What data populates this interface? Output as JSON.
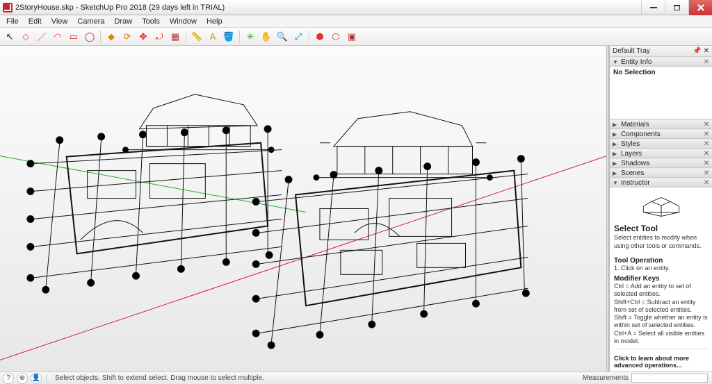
{
  "title": "2StoryHouse.skp - SketchUp Pro 2018 (29 days left in TRIAL)",
  "menu": [
    "File",
    "Edit",
    "View",
    "Camera",
    "Draw",
    "Tools",
    "Window",
    "Help"
  ],
  "toolbar": [
    {
      "id": "select",
      "glyph": "↖",
      "color": "#222"
    },
    {
      "id": "eraser",
      "glyph": "◇",
      "color": "#e48"
    },
    {
      "id": "line",
      "glyph": "／",
      "color": "#e23"
    },
    {
      "id": "arc",
      "glyph": "◠",
      "color": "#e23"
    },
    {
      "id": "rect",
      "glyph": "▭",
      "color": "#d22"
    },
    {
      "id": "circle",
      "glyph": "◯",
      "color": "#b22"
    },
    {
      "id": "sep"
    },
    {
      "id": "pushpull",
      "glyph": "◆",
      "color": "#d80"
    },
    {
      "id": "offset",
      "glyph": "⟳",
      "color": "#d80"
    },
    {
      "id": "move",
      "glyph": "✥",
      "color": "#d22"
    },
    {
      "id": "rotate",
      "glyph": "⤾",
      "color": "#d22"
    },
    {
      "id": "scale",
      "glyph": "▦",
      "color": "#b33"
    },
    {
      "id": "sep"
    },
    {
      "id": "tape",
      "glyph": "📏",
      "color": "#c90"
    },
    {
      "id": "text",
      "glyph": "A",
      "color": "#c90"
    },
    {
      "id": "paint",
      "glyph": "🪣",
      "color": "#c90"
    },
    {
      "id": "sep"
    },
    {
      "id": "orbit",
      "glyph": "✳",
      "color": "#2a2"
    },
    {
      "id": "pan",
      "glyph": "✋",
      "color": "#2a2"
    },
    {
      "id": "zoom",
      "glyph": "🔍",
      "color": "#08c"
    },
    {
      "id": "zoom-ext",
      "glyph": "⤢",
      "color": "#08c"
    },
    {
      "id": "sep"
    },
    {
      "id": "warehouse",
      "glyph": "⬢",
      "color": "#d33"
    },
    {
      "id": "ext",
      "glyph": "⬡",
      "color": "#d33"
    },
    {
      "id": "layout",
      "glyph": "▣",
      "color": "#b33"
    }
  ],
  "tray": {
    "title": "Default Tray",
    "panels": [
      {
        "id": "entity-info",
        "label": "Entity Info",
        "open": true,
        "content": "No Selection"
      },
      {
        "id": "materials",
        "label": "Materials",
        "open": false
      },
      {
        "id": "components",
        "label": "Components",
        "open": false
      },
      {
        "id": "styles",
        "label": "Styles",
        "open": false
      },
      {
        "id": "layers",
        "label": "Layers",
        "open": false
      },
      {
        "id": "shadows",
        "label": "Shadows",
        "open": false
      },
      {
        "id": "scenes",
        "label": "Scenes",
        "open": false
      },
      {
        "id": "instructor",
        "label": "Instructor",
        "open": true
      }
    ]
  },
  "instructor": {
    "title": "Select Tool",
    "desc": "Select entities to modify when using other tools or commands.",
    "op_hdr": "Tool Operation",
    "op_1": "1. Click on an entity.",
    "mod_hdr": "Modifier Keys",
    "mod_1": "Ctrl = Add an entity to set of selected entities.",
    "mod_2": "Shift+Ctrl = Subtract an entity from set of selected entities.",
    "mod_3": "Shift = Toggle whether an entity is within set of selected entities.",
    "mod_4": "Ctrl+A = Select all visible entities in model.",
    "more": "Click to learn about more advanced operations..."
  },
  "status": {
    "hint": "Select objects. Shift to extend select. Drag mouse to select multiple.",
    "meas_label": "Measurements",
    "meas_value": ""
  }
}
